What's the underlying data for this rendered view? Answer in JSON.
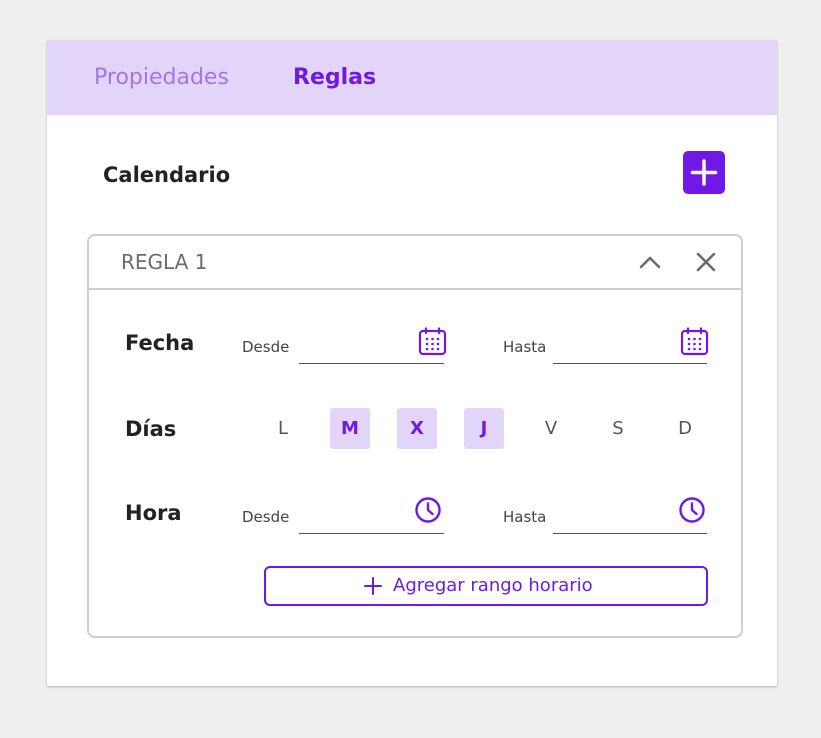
{
  "tabs": {
    "properties": "Propiedades",
    "rules": "Reglas"
  },
  "section": {
    "title": "Calendario"
  },
  "rule": {
    "title": "REGLA 1",
    "date": {
      "label": "Fecha",
      "from_label": "Desde",
      "to_label": "Hasta",
      "from_value": "",
      "to_value": ""
    },
    "days": {
      "label": "Días",
      "items": [
        {
          "letter": "L",
          "selected": false
        },
        {
          "letter": "M",
          "selected": true
        },
        {
          "letter": "X",
          "selected": true
        },
        {
          "letter": "J",
          "selected": true
        },
        {
          "letter": "V",
          "selected": false
        },
        {
          "letter": "S",
          "selected": false
        },
        {
          "letter": "D",
          "selected": false
        }
      ]
    },
    "time": {
      "label": "Hora",
      "from_label": "Desde",
      "to_label": "Hasta",
      "from_value": "",
      "to_value": ""
    },
    "add_range_label": "Agregar rango horario"
  },
  "colors": {
    "accent": "#7019e6",
    "accent_light": "#e3d5f9",
    "tab_inactive": "#a077e6"
  },
  "icons": [
    "plus-icon",
    "chevron-up-icon",
    "close-icon",
    "calendar-icon",
    "clock-icon"
  ]
}
